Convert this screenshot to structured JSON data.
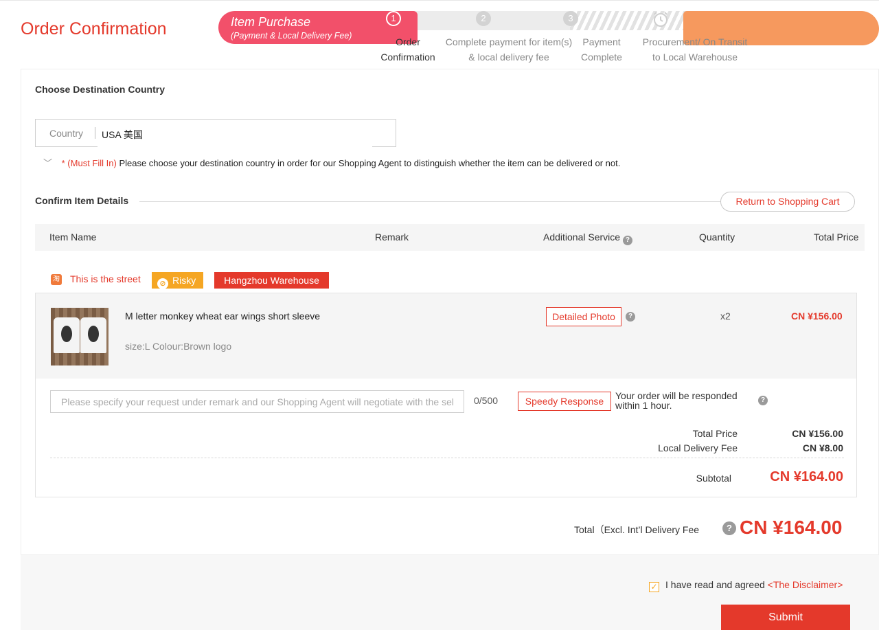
{
  "header": {
    "title": "Order Confirmation",
    "banner_title": "Item Purchase",
    "banner_subtitle": "(Payment & Local Delivery Fee)",
    "steps": [
      {
        "num": "1",
        "line1": "Order",
        "line2": "Confirmation"
      },
      {
        "num": "2",
        "line1": "Complete payment for item(s)",
        "line2": "& local delivery fee"
      },
      {
        "num": "3",
        "line1": "Payment",
        "line2": "Complete"
      },
      {
        "num": "",
        "line1": "Procurement/ On Transit",
        "line2": "to Local Warehouse"
      }
    ]
  },
  "destination": {
    "title": "Choose Destination Country",
    "country_label": "Country",
    "country_value": "USA 美国",
    "hint_required": "* (Must Fill In)",
    "hint_text": "Please choose your destination country in order for our Shopping Agent to distinguish whether the item can be delivered or not."
  },
  "details": {
    "title": "Confirm Item Details",
    "return_button": "Return to Shopping Cart",
    "columns": [
      "Item Name",
      "Remark",
      "Additional Service",
      "Quantity",
      "Total Price"
    ]
  },
  "shop": {
    "icon_glyph": "淘",
    "name": "This is the street",
    "risk_tag": "Risky",
    "warehouse_tag": "Hangzhou Warehouse"
  },
  "item": {
    "name": "M letter monkey wheat ear wings short sleeve",
    "attributes": "size:L Colour:Brown logo",
    "service_button": "Detailed Photo",
    "quantity": "x2",
    "price": "CN ¥156.00"
  },
  "remark": {
    "placeholder": "Please specify your request under remark and our Shopping Agent will negotiate with the seller",
    "counter": "0/500",
    "speedy_button": "Speedy Response",
    "speedy_note": "Your order will be responded within 1 hour."
  },
  "summary": {
    "total_price_label": "Total Price",
    "total_price_value": "CN ¥156.00",
    "delivery_label": "Local Delivery Fee",
    "delivery_value": "CN ¥8.00",
    "subtotal_label": "Subtotal",
    "subtotal_value": "CN ¥164.00"
  },
  "grand_total": {
    "label": "Total（Excl. Int’l Delivery Fee",
    "value": "CN ¥164.00"
  },
  "footer": {
    "agree_text": "I have read and agreed",
    "disclaimer_link": "<The Disclaimer>",
    "agreed": true,
    "submit_label": "Submit"
  },
  "colors": {
    "accent_red": "#e4392b",
    "banner_pink": "#f2506a",
    "risky_orange": "#f5a623"
  },
  "icons": [
    "chevron-down-icon",
    "question-icon",
    "taobao-shop-icon",
    "ban-icon",
    "clock-icon",
    "checkbox-checked-icon"
  ]
}
